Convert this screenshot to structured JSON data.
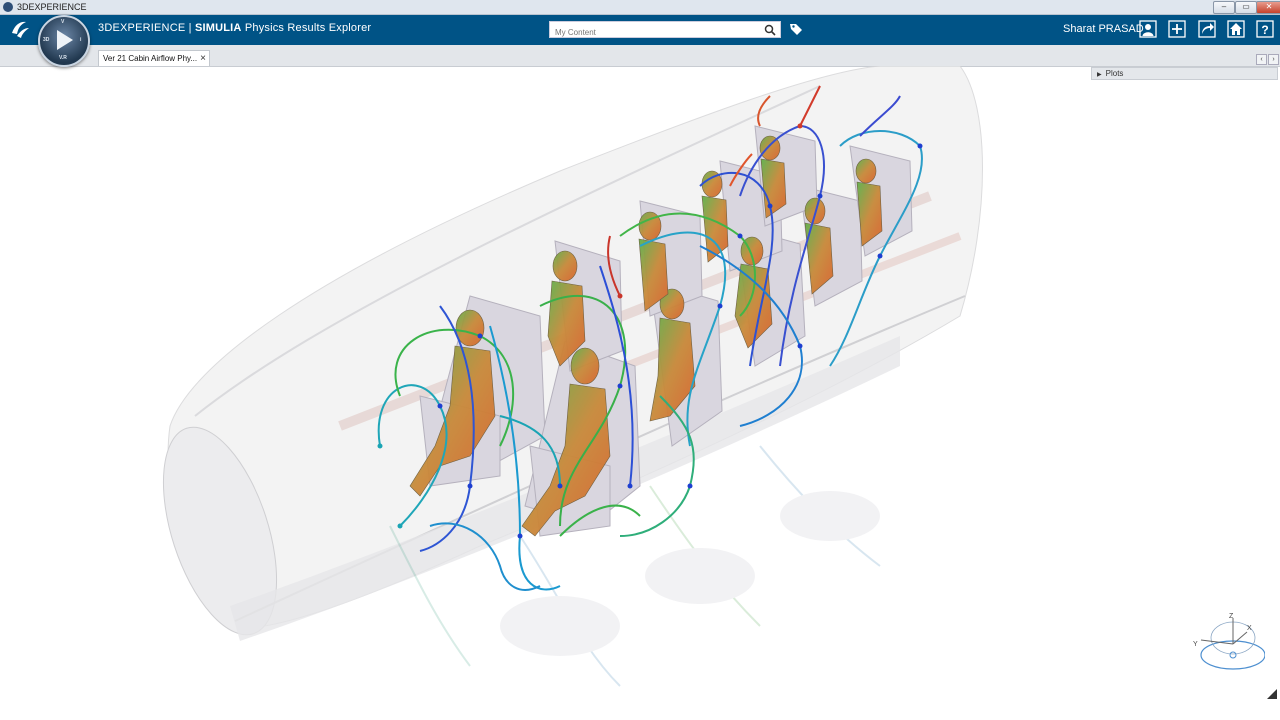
{
  "window": {
    "title": "3DEXPERIENCE",
    "buttons": [
      "–",
      "▭",
      "✕"
    ]
  },
  "header": {
    "brand_prefix": "3DEXPERIENCE | ",
    "brand_bold": "SIMULIA",
    "brand_suffix": " Physics Results Explorer",
    "user_name": "Sharat PRASAD"
  },
  "compass": {
    "labels": [
      "V",
      "3D",
      "V.R",
      "i"
    ]
  },
  "search": {
    "placeholder": "My Content"
  },
  "tabs": [
    {
      "label": "Ver 21 Cabin Airflow Phy..."
    }
  ],
  "panel": {
    "plots_label": "Plots"
  },
  "triad": {
    "x": "X",
    "y": "Y",
    "z": "Z"
  },
  "colors": {
    "accent": "#005386",
    "streamline_hot": "#e03d2b",
    "streamline_cold": "#1f3fd0",
    "passenger_warm": "#d4742c",
    "passenger_cool": "#4fae4a"
  },
  "icons": [
    "ds-logo-icon",
    "search-icon",
    "tag-icon",
    "user-icon",
    "plus-icon",
    "share-icon",
    "home-icon",
    "help-icon",
    "triad-icon"
  ]
}
